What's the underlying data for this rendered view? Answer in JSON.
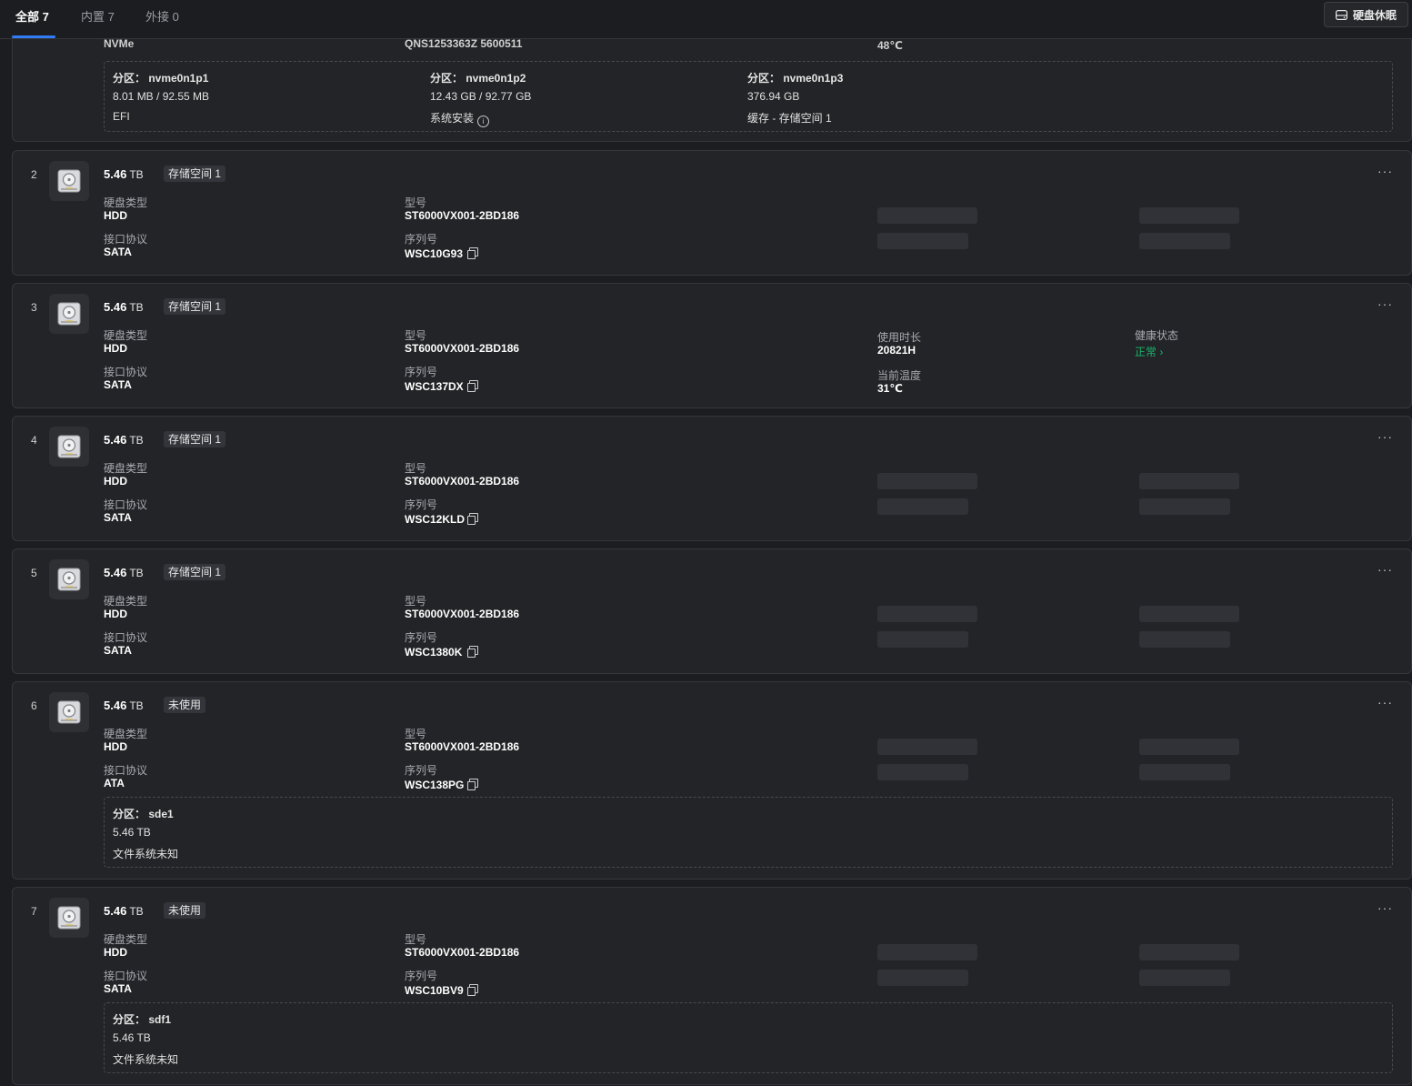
{
  "tabs": [
    {
      "label": "全部 7"
    },
    {
      "label": "内置 7"
    },
    {
      "label": "外接 0"
    }
  ],
  "sleep_button": {
    "label": "硬盘休眠"
  },
  "colors": {
    "accent": "#2f7cf6",
    "health_ok": "#19b36b"
  },
  "disk1_partial": {
    "clipped_left": "NVMe",
    "clipped_mid": "QNS1253363Z 5600511",
    "clipped_right": "48℃",
    "partitions": [
      {
        "title": "分区： nvme0n1p1",
        "size": "8.01 MB / 92.55 MB",
        "usage": "EFI"
      },
      {
        "title": "分区： nvme0n1p2",
        "size": "12.43 GB / 92.77 GB",
        "usage": "系统安装"
      },
      {
        "title": "分区： nvme0n1p3",
        "size": "376.94 GB",
        "usage": "缓存 - 存储空间 1"
      }
    ]
  },
  "labels": {
    "disk_type": "硬盘类型",
    "protocol": "接口协议",
    "model": "型号",
    "serial": "序列号",
    "uptime": "使用时长",
    "temperature": "当前温度",
    "health": "健康状态",
    "unit_tb": "TB"
  },
  "disks": [
    {
      "index": "2",
      "capacity": "5.46",
      "tag": "存储空间 1",
      "type": "HDD",
      "protocol": "SATA",
      "model": "ST6000VX001-2BD186",
      "serial": "WSC10G93"
    },
    {
      "index": "3",
      "capacity": "5.46",
      "tag": "存储空间 1",
      "type": "HDD",
      "protocol": "SATA",
      "model": "ST6000VX001-2BD186",
      "serial": "WSC137DX",
      "uptime": "20821H",
      "temperature": "31℃",
      "health": "正常"
    },
    {
      "index": "4",
      "capacity": "5.46",
      "tag": "存储空间 1",
      "type": "HDD",
      "protocol": "SATA",
      "model": "ST6000VX001-2BD186",
      "serial": "WSC12KLD"
    },
    {
      "index": "5",
      "capacity": "5.46",
      "tag": "存储空间 1",
      "type": "HDD",
      "protocol": "SATA",
      "model": "ST6000VX001-2BD186",
      "serial": "WSC1380K"
    },
    {
      "index": "6",
      "capacity": "5.46",
      "tag": "未使用",
      "type": "HDD",
      "protocol": "ATA",
      "model": "ST6000VX001-2BD186",
      "serial": "WSC138PG",
      "partition": {
        "title": "分区： sde1",
        "size": "5.46 TB",
        "fs": "文件系统未知"
      }
    },
    {
      "index": "7",
      "capacity": "5.46",
      "tag": "未使用",
      "type": "HDD",
      "protocol": "SATA",
      "model": "ST6000VX001-2BD186",
      "serial": "WSC10BV9",
      "partition": {
        "title": "分区： sdf1",
        "size": "5.46 TB",
        "fs": "文件系统未知"
      }
    }
  ]
}
